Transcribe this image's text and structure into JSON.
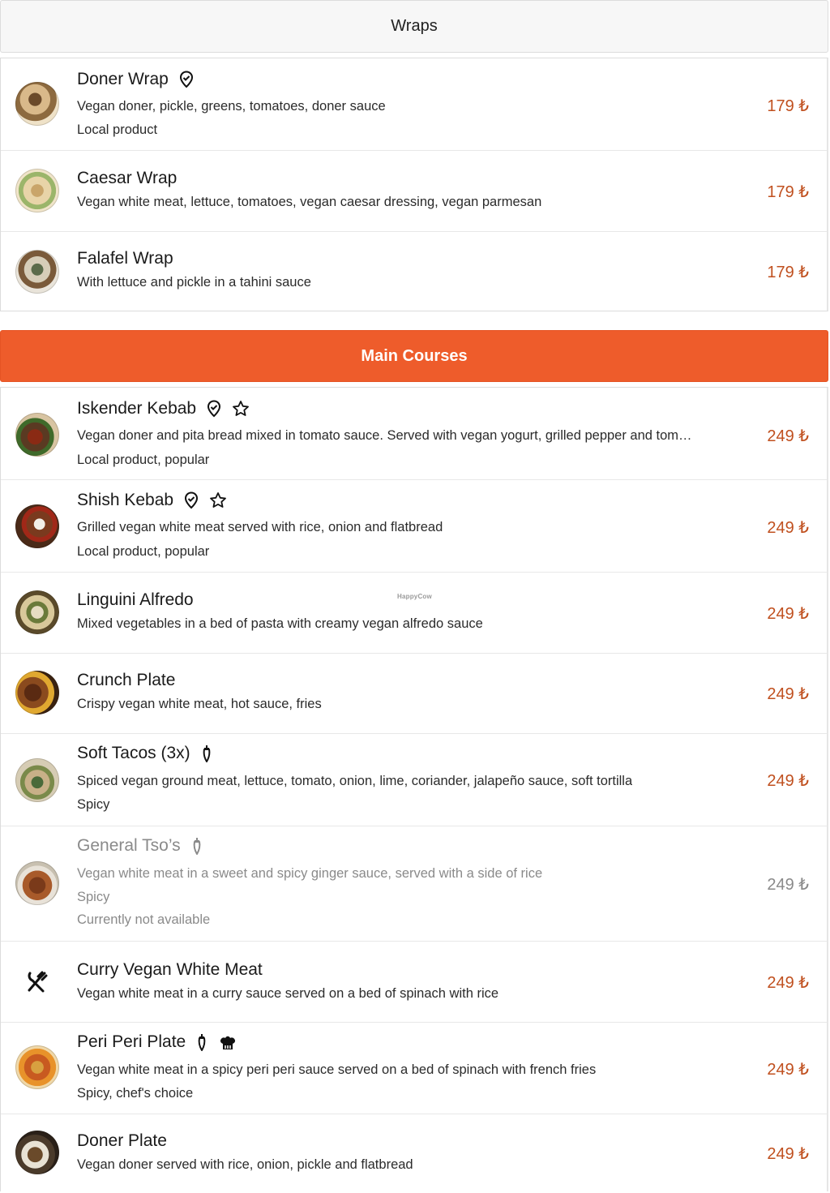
{
  "sections": {
    "wraps": {
      "label": "Wraps"
    },
    "main_courses": {
      "label": "Main Courses"
    }
  },
  "wraps_items": [
    {
      "name": "Doner Wrap",
      "description": "Vegan doner, pickle, greens, tomatoes, doner sauce",
      "tags": "Local product",
      "price": "179 ₺",
      "icons": [
        "location-pin-icon"
      ]
    },
    {
      "name": "Caesar Wrap",
      "description": "Vegan white meat, lettuce, tomatoes, vegan caesar dressing, vegan parmesan",
      "price": "179 ₺"
    },
    {
      "name": "Falafel Wrap",
      "description": "With lettuce and pickle in a tahini sauce",
      "price": "179 ₺"
    }
  ],
  "main_items": [
    {
      "name": "Iskender Kebab",
      "description": "Vegan doner and pita bread mixed in tomato sauce. Served with vegan yogurt, grilled pepper and tom…",
      "tags": "Local product, popular",
      "price": "249 ₺",
      "icons": [
        "location-pin-icon",
        "star-icon"
      ]
    },
    {
      "name": "Shish Kebab",
      "description": "Grilled vegan white meat served with rice, onion and flatbread",
      "tags": "Local product, popular",
      "price": "249 ₺",
      "icons": [
        "location-pin-icon",
        "star-icon"
      ]
    },
    {
      "name": "Linguini Alfredo",
      "description": "Mixed vegetables in a bed of pasta with creamy vegan alfredo sauce",
      "price": "249 ₺"
    },
    {
      "name": "Crunch Plate",
      "description": "Crispy vegan white meat, hot sauce, fries",
      "price": "249 ₺"
    },
    {
      "name": "Soft Tacos (3x)",
      "description": "Spiced vegan ground meat, lettuce, tomato, onion, lime, coriander, jalapeño sauce, soft tortilla",
      "tags": "Spicy",
      "price": "249 ₺",
      "icons": [
        "chili-pepper-icon"
      ]
    },
    {
      "name": "General Tso’s",
      "description": "Vegan white meat in a sweet and spicy ginger sauce, served with a side of rice",
      "tags": "Spicy",
      "availability": "Currently not available",
      "price": "249 ₺",
      "icons": [
        "chili-pepper-icon"
      ]
    },
    {
      "name": "Curry Vegan White Meat",
      "description": "Vegan white meat in a curry sauce served on a bed of spinach with rice",
      "price": "249 ₺",
      "icons": [
        "cutlery-icon"
      ]
    },
    {
      "name": "Peri Peri Plate",
      "description": "Vegan white meat in a spicy peri peri sauce served on a bed of spinach with french fries",
      "tags": "Spicy, chef's choice",
      "price": "249 ₺",
      "icons": [
        "chili-pepper-icon",
        "chef-hat-icon"
      ]
    },
    {
      "name": "Doner Plate",
      "description": "Vegan doner served with rice, onion, pickle and flatbread",
      "price": "249 ₺"
    }
  ],
  "watermark": "HappyCow",
  "colors": {
    "accent": "#ee5c2b",
    "price": "#c0501f",
    "muted": "#8a8a8a"
  }
}
